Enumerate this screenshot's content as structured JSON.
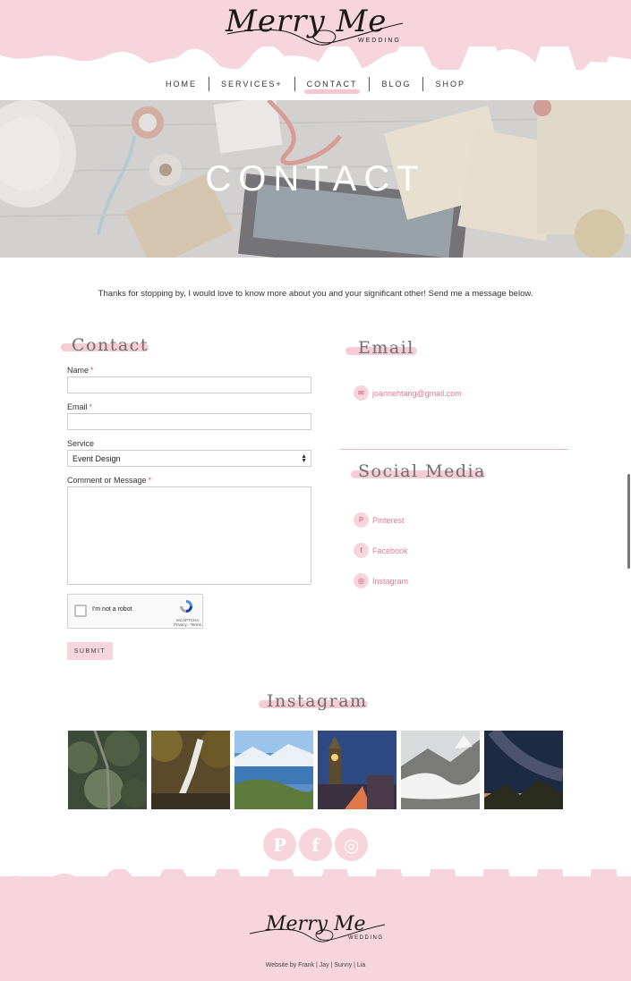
{
  "brand": {
    "logo_script": "Merry Me",
    "logo_sub": "WEDDING"
  },
  "nav": {
    "items": [
      {
        "label": "HOME"
      },
      {
        "label": "SERVICES+"
      },
      {
        "label": "CONTACT"
      },
      {
        "label": "BLOG"
      },
      {
        "label": "SHOP"
      }
    ],
    "active": "CONTACT"
  },
  "hero": {
    "title": "CONTACT"
  },
  "intro": "Thanks for stopping by, I would love to know more about you and your significant other! Send me a message below.",
  "form": {
    "heading": "Contact",
    "name_label": "Name",
    "email_label": "Email",
    "service_label": "Service",
    "service_value": "Event Design",
    "message_label": "Comment or Message",
    "required_mark": "*",
    "captcha_text": "I'm not a robot",
    "captcha_brand": "reCAPTCHA",
    "captcha_terms": "Privacy - Terms",
    "submit_label": "SUBMIT"
  },
  "email_section": {
    "heading": "Email",
    "address": "joannehtang@gmail.com"
  },
  "social_section": {
    "heading": "Social Media",
    "links": [
      {
        "label": "Pinterest",
        "icon": "pinterest-icon"
      },
      {
        "label": "Facebook",
        "icon": "facebook-icon"
      },
      {
        "label": "Instagram",
        "icon": "instagram-icon"
      }
    ]
  },
  "instagram": {
    "heading": "Instagram",
    "photos": [
      "forest-photo",
      "waterfall-photo",
      "lake-photo",
      "clocktower-photo",
      "glacier-photo",
      "milky-way-photo"
    ]
  },
  "footer": {
    "credit": "Website by Frank | Jay | Sunny | Lia"
  },
  "colors": {
    "accent_pink": "#f7d5dc",
    "link_pink": "#e07a95",
    "heading_gray": "#6e6e6e"
  }
}
